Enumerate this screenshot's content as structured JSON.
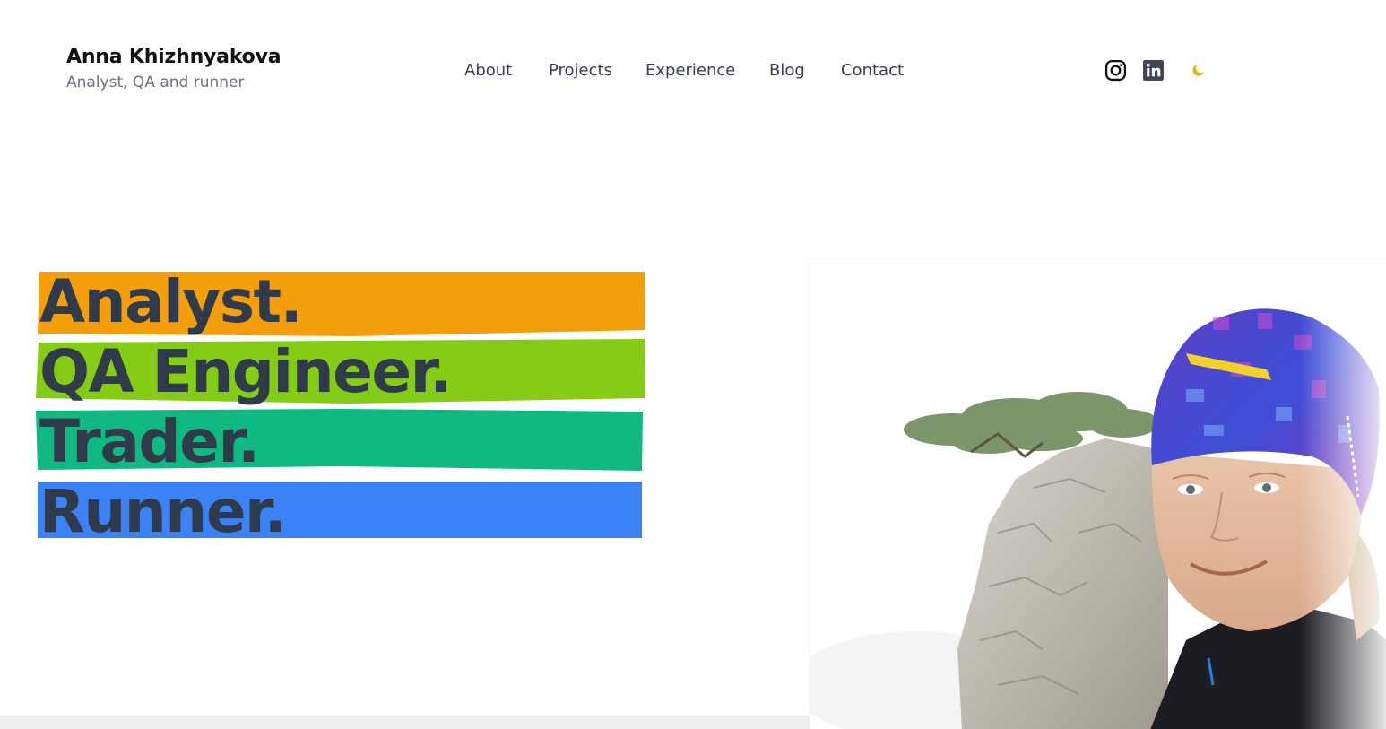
{
  "brand": {
    "name": "Anna Khizhnyakova",
    "tagline": "Analyst, QA and runner"
  },
  "nav": {
    "items": [
      {
        "label": "About"
      },
      {
        "label": "Projects"
      },
      {
        "label": "Experience"
      },
      {
        "label": "Blog"
      },
      {
        "label": "Contact"
      }
    ]
  },
  "header_icons": {
    "instagram": "instagram-icon",
    "linkedin": "linkedin-icon",
    "theme_toggle": "moon-icon",
    "theme_color": "#eab308"
  },
  "hero": {
    "words": [
      {
        "text": "Analyst.",
        "color": "#f59e0b"
      },
      {
        "text": "QA Engineer.",
        "color": "#84cc16"
      },
      {
        "text": "Trader.",
        "color": "#10b981"
      },
      {
        "text": "Runner.",
        "color": "#3b82f6"
      }
    ],
    "text_color": "#2f3a4a"
  }
}
